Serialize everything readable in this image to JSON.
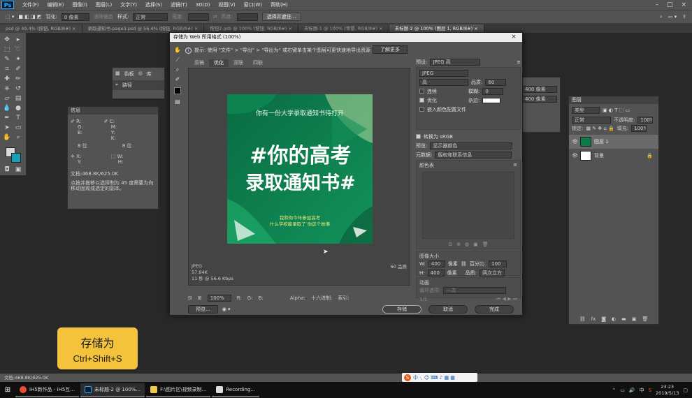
{
  "menubar": {
    "logo": "Ps",
    "items": [
      "文件(F)",
      "编辑(E)",
      "图像(I)",
      "图层(L)",
      "文字(Y)",
      "选择(S)",
      "滤镜(T)",
      "3D(D)",
      "视图(V)",
      "窗口(W)",
      "帮助(H)"
    ]
  },
  "options": {
    "feather_label": "羽化:",
    "feather_value": "0 像素",
    "antialias": "消除锯齿",
    "style_label": "样式:",
    "style_value": "正常",
    "width_label": "宽度:",
    "height_label": "高度:",
    "select_btn": "选择并遮住..."
  },
  "tabs": [
    {
      "label": "psd @ 49.4% (按钮, RGB/8#) ×",
      "active": false
    },
    {
      "label": "录取通知书-page3.psd @ 56.4% (按钮, RGB/8#) ×",
      "active": false
    },
    {
      "label": "按钮2.psb @ 100% (按钮, RGB/8#) ×",
      "active": false
    },
    {
      "label": "未标题-1 @ 100% (背景, RGB/8#) ×",
      "active": false
    },
    {
      "label": "未标题-2 @ 100% (图层 1, RGB/8#) ×",
      "active": true
    }
  ],
  "colors_panel": {
    "tab1": "色板",
    "tab2": "库",
    "tab3": "路径"
  },
  "info_panel": {
    "title": "信息",
    "r": "R:",
    "g": "G:",
    "b": "B:",
    "c": "C:",
    "m": "M:",
    "y": "Y:",
    "k": "K:",
    "bits1": "8 位",
    "bits2": "8 位",
    "x": "X:",
    "y_pos": "Y:",
    "w": "W:",
    "h": "H:",
    "doc": "文档:468.8K/625.0K",
    "hint": "点按并拖移以选择制为 45 度需要为向移动固观或选定的副本。"
  },
  "dialog": {
    "title": "存储为 Web 所用格式 (100%)",
    "close": "×",
    "tip": "提示: 使用 \"文件\" > \"导出\" > \"导出为\" 或右键单击某个图层可更快速地导出资源",
    "learn_more": "了解更多",
    "view_tabs": [
      "原稿",
      "优化",
      "双联",
      "四联"
    ],
    "image": {
      "subtitle": "你有一份大学录取通知书待打开",
      "headline1": "#你的高考",
      "headline2": "录取通知书#",
      "line1": "我和你今年参加高考",
      "line2": "什么学校能录取了 你这个故事"
    },
    "info_format": "JPEG",
    "info_size": "57.94K",
    "info_time": "11 秒 @ 56.6 Kbps",
    "info_quality": "60 品质",
    "zoom": "100%",
    "r_label": "R:",
    "g_label": "G:",
    "b_label": "B:",
    "alpha_label": "Alpha:",
    "hex_label": "十六进制:",
    "index_label": "索引:",
    "preview_btn": "预览...",
    "save_btn": "存储",
    "cancel_btn": "取消",
    "done_btn": "完成",
    "preset_label": "预设:",
    "preset_value": "JPEG 高",
    "format_value": "JPEG",
    "quality_level": "高",
    "quality_label": "品质:",
    "quality_value": "60",
    "progressive": "连续",
    "blur_label": "模糊:",
    "blur_value": "0",
    "optimized": "优化",
    "matte_label": "杂边:",
    "embed_profile": "嵌入颜色配置文件",
    "convert_srgb": "转换为 sRGB",
    "preview_label": "预览:",
    "preview_value": "显示器颜色",
    "metadata_label": "元数据:",
    "metadata_value": "版权和联系信息",
    "color_table": "颜色表",
    "image_size": "图像大小",
    "w_label": "W:",
    "w_value": "400",
    "h_label": "H:",
    "h_value": "400",
    "unit": "像素",
    "percent_label": "百分比:",
    "percent_value": "100",
    "quality_mode_label": "品质:",
    "quality_mode_value": "两次立方",
    "animation": "动画",
    "loop_label": "循环选项:",
    "loop_value": "一次",
    "frame": "1/1"
  },
  "layers_panel": {
    "title": "图层",
    "kind": "类型",
    "blend": "正常",
    "opacity_label": "不透明度:",
    "opacity_value": "100%",
    "lock_label": "锁定:",
    "fill_label": "填充:",
    "fill_value": "100%",
    "layers": [
      {
        "name": "图层 1",
        "selected": true
      },
      {
        "name": "背景",
        "selected": false
      }
    ]
  },
  "bg_panel": {
    "v1": "400 像素",
    "v2": "400 像素"
  },
  "statusbar": "文档:468.8K/625.0K",
  "shortcut": {
    "line1": "存储为",
    "line2": "Ctrl+Shift+S"
  },
  "taskbar": {
    "items": [
      {
        "label": "iH5新作品 - iH5互...",
        "active": false
      },
      {
        "label": "未标题-2 @ 100%...",
        "active": true
      },
      {
        "label": "F:\\图片区\\视频录制...",
        "active": false
      },
      {
        "label": "Recording...",
        "active": false
      }
    ],
    "time": "23:23",
    "date": "2019/5/13",
    "ime": "中"
  }
}
